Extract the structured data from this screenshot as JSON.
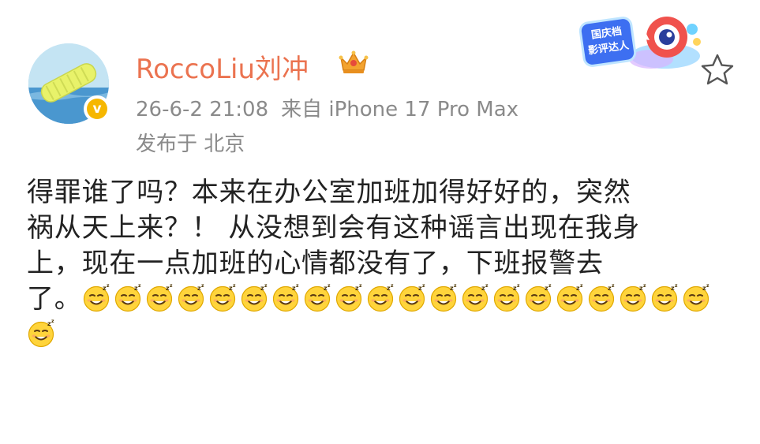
{
  "post": {
    "username": "RoccoLiu刘冲",
    "timestamp": "26-6-2 21:08",
    "source": "来自 iPhone 17 Pro Max",
    "location": "发布于 北京",
    "text_line1": "得罪谁了吗？本来在办公室加班加得好好的，突然",
    "text_line2": "祸从天上来？！ 从没想到会有这种谣言出现在我身",
    "text_line3": "上，现在一点加班的心情都没有了，下班报警去",
    "text_line4_start": "了。",
    "emoji_name": "sleepy-smile-emoji",
    "emoji_count_line4": 20,
    "emoji_count_line5": 1
  },
  "badge": {
    "text": "国庆档影评达人",
    "line1": "国庆档",
    "line2": "影评达人"
  },
  "icons": {
    "crown": "crown-icon",
    "verified": "verified-v-icon",
    "star": "star-icon"
  },
  "verified_letter": "v",
  "bottom_partial": "",
  "colors": {
    "username": "#eb7350",
    "meta": "#8a8a8a",
    "text": "#222222",
    "verified": "#f6b700",
    "badge": "#3d6ff1"
  }
}
